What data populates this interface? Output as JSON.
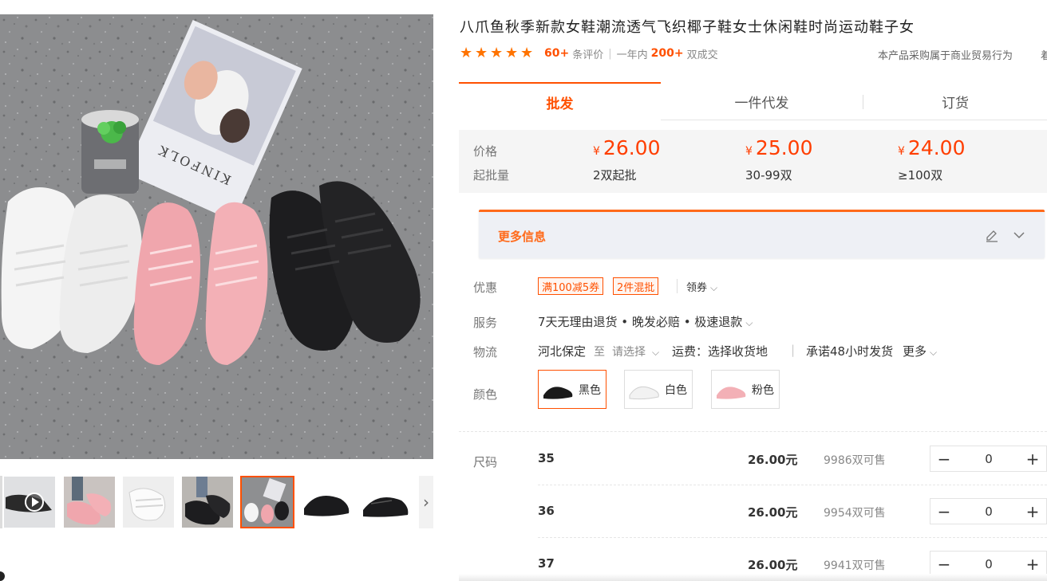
{
  "product": {
    "title": "八爪鱼秋季新款女鞋潮流透气飞织椰子鞋女士休闲鞋时尚运动鞋子女",
    "rating_stars": 5,
    "review_count": "60+",
    "review_label": "条评价",
    "year_label": "一年内",
    "deal_count": "200+",
    "deal_label": "双成交",
    "trade_note": "本产品采购属于商业贸易行为",
    "trade_note_tail": "着"
  },
  "tabs": [
    {
      "label": "批发"
    },
    {
      "label": "一件代发"
    },
    {
      "label": "订货"
    }
  ],
  "pricing": {
    "price_label": "价格",
    "min_label": "起批量",
    "currency": "¥",
    "tiers": [
      {
        "price": "26.00",
        "min": "2双起批"
      },
      {
        "price": "25.00",
        "min": "30-99双"
      },
      {
        "price": "24.00",
        "min": "≥100双"
      }
    ]
  },
  "more_info": {
    "label": "更多信息"
  },
  "offers": {
    "label": "优惠",
    "coupons": [
      "满100减5券",
      "2件混批"
    ],
    "get_label": "领券"
  },
  "service": {
    "label": "服务",
    "text": "7天无理由退货 • 晚发必赔 • 极速退款"
  },
  "logistics": {
    "label": "物流",
    "from": "河北保定",
    "to_word": "至",
    "select": "请选择",
    "shipping": "运费：选择收货地",
    "promise": "承诺48小时发货",
    "more": "更多"
  },
  "colors": {
    "label": "颜色",
    "options": [
      {
        "name": "黑色",
        "swatch": "#1a1a1a",
        "selected": true
      },
      {
        "name": "白色",
        "swatch": "#f2f2f2",
        "selected": false
      },
      {
        "name": "粉色",
        "swatch": "#f3b0b6",
        "selected": false
      }
    ]
  },
  "sizes": {
    "label": "尺码",
    "rows": [
      {
        "size": "35",
        "price": "26.00元",
        "stock": "9986双可售",
        "qty": "0"
      },
      {
        "size": "36",
        "price": "26.00元",
        "stock": "9954双可售",
        "qty": "0"
      },
      {
        "size": "37",
        "price": "26.00元",
        "stock": "9941双可售",
        "qty": "0"
      }
    ]
  },
  "gallery": {
    "kinfolk_text": "KINFOLK",
    "thumbnails": [
      "video",
      "pink-worn",
      "white",
      "black-worn",
      "group",
      "black-single",
      "black-side"
    ],
    "active_thumbnail": 4
  },
  "colors_theme": {
    "accent": "#ff5000",
    "price": "#ff3e00"
  }
}
